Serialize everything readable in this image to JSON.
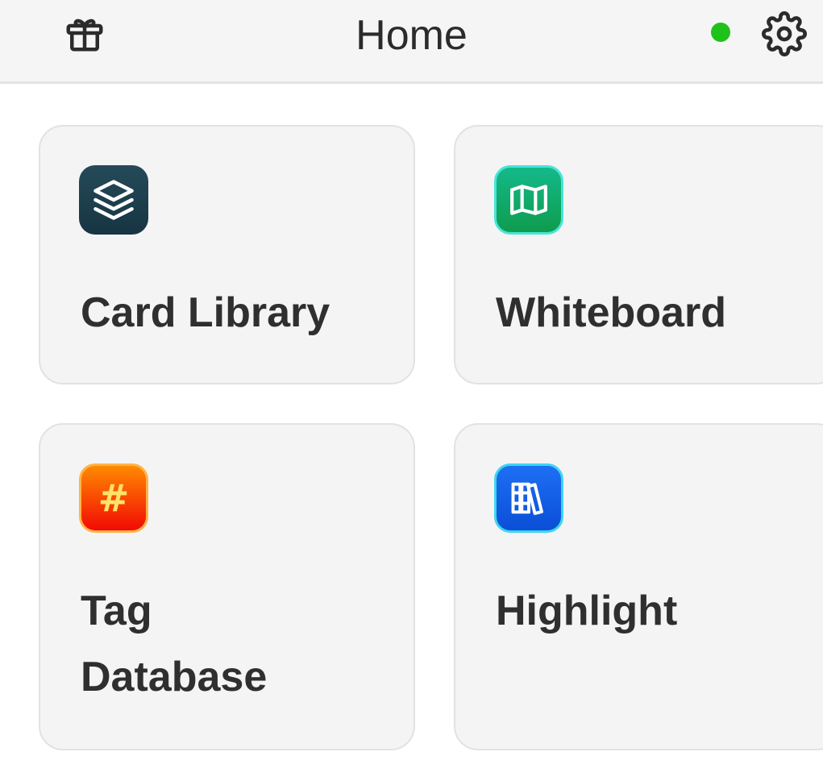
{
  "header": {
    "title": "Home",
    "gift_icon": "gift-icon",
    "status_color": "#1fc21b",
    "settings_icon": "gear-icon"
  },
  "cards": [
    {
      "label": "Card Library",
      "icon": "layers-icon",
      "accent": "#1d3c4a"
    },
    {
      "label": "Whiteboard",
      "icon": "map-icon",
      "accent": "#11a865"
    },
    {
      "label_lines": [
        "Tag",
        "Database"
      ],
      "icon": "hashtag-icon",
      "icon_text": "#",
      "accent": "#ff5a00"
    },
    {
      "label": "Highlight",
      "icon": "books-icon",
      "accent": "#155fe8"
    }
  ]
}
